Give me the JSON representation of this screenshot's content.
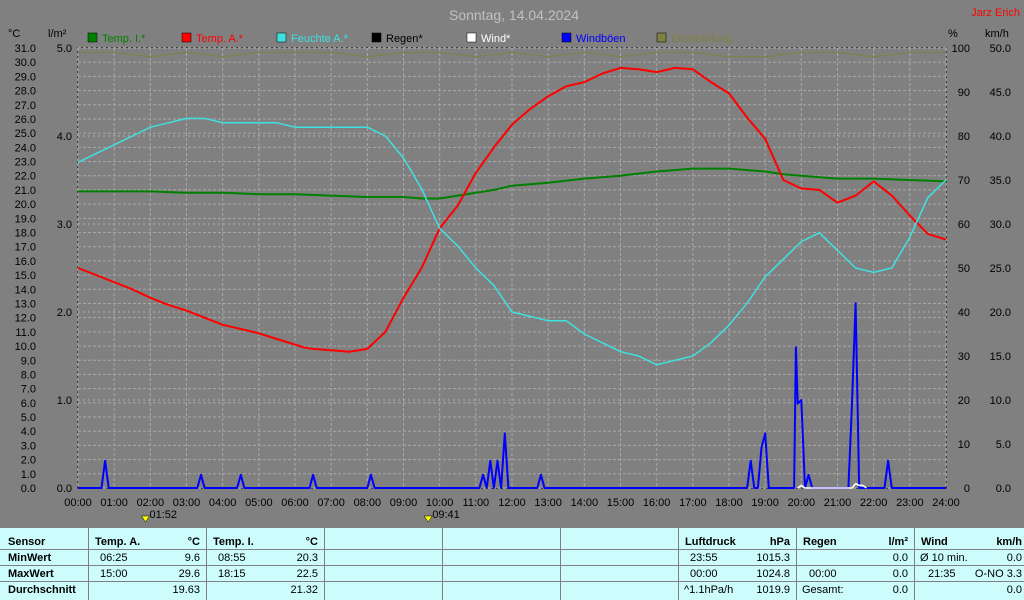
{
  "title": "Sonntag, 14.04.2024",
  "station": "Jarz Erich",
  "units": {
    "left_outer": "°C",
    "left_inner": "l/m²",
    "right_inner": "%",
    "right_outer": "km/h"
  },
  "colors": {
    "bg": "#808080",
    "plot_bg": "#808080",
    "grid": "#a8a8a8",
    "temp_in": "#008000",
    "temp_out": "#ff0000",
    "humidity": "#40e0e0",
    "rain": "#000000",
    "wind": "#ffffff",
    "gust": "#0000ff",
    "solar": "#808040"
  },
  "chart_data": {
    "type": "line",
    "title": "Sonntag, 14.04.2024",
    "x_unit": "hours",
    "xlim": [
      0,
      24
    ],
    "x_ticks": [
      "00:00",
      "01:00",
      "02:00",
      "03:00",
      "04:00",
      "05:00",
      "06:00",
      "07:00",
      "08:00",
      "09:00",
      "10:00",
      "11:00",
      "12:00",
      "13:00",
      "14:00",
      "15:00",
      "16:00",
      "17:00",
      "18:00",
      "19:00",
      "20:00",
      "21:00",
      "22:00",
      "23:00",
      "24:00"
    ],
    "axes": {
      "temp_c": {
        "ylim": [
          0,
          31
        ],
        "ticks": [
          "0.0",
          "1.0",
          "2.0",
          "3.0",
          "4.0",
          "5.0",
          "6.0",
          "7.0",
          "8.0",
          "9.0",
          "10.0",
          "11.0",
          "12.0",
          "13.0",
          "14.0",
          "15.0",
          "16.0",
          "17.0",
          "18.0",
          "19.0",
          "20.0",
          "21.0",
          "22.0",
          "23.0",
          "24.0",
          "25.0",
          "26.0",
          "27.0",
          "28.0",
          "29.0",
          "30.0",
          "31.0"
        ]
      },
      "rain_lm2": {
        "ylim": [
          0,
          5
        ],
        "ticks": [
          "0.0",
          "1.0",
          "2.0",
          "3.0",
          "4.0",
          "5.0"
        ]
      },
      "humidity_pct": {
        "ylim": [
          0,
          100
        ],
        "ticks": [
          "0",
          "10",
          "20",
          "30",
          "40",
          "50",
          "60",
          "70",
          "80",
          "90",
          "100"
        ]
      },
      "wind_kmh": {
        "ylim": [
          0,
          50
        ],
        "ticks": [
          "0.0",
          "5.0",
          "10.0",
          "15.0",
          "20.0",
          "25.0",
          "30.0",
          "35.0",
          "40.0",
          "45.0",
          "50.0"
        ]
      }
    },
    "legend": [
      "Temp. I.*",
      "Temp. A.*",
      "Feuchte A.*",
      "Regen*",
      "Wind*",
      "Windböen",
      "Einstrahlung"
    ],
    "series": [
      {
        "name": "Temp. I.*",
        "axis": "temp_c",
        "color": "#008000",
        "x": [
          0,
          1,
          2,
          3,
          4,
          5,
          6,
          7,
          8,
          9,
          9.5,
          10,
          10.5,
          11,
          11.5,
          12,
          13,
          14,
          15,
          16,
          17,
          18,
          19,
          19.5,
          20,
          21,
          22,
          23,
          24
        ],
        "y": [
          20.9,
          20.9,
          20.9,
          20.8,
          20.8,
          20.7,
          20.7,
          20.6,
          20.5,
          20.5,
          20.4,
          20.4,
          20.6,
          20.8,
          21.0,
          21.3,
          21.5,
          21.8,
          22.0,
          22.3,
          22.5,
          22.5,
          22.3,
          22.1,
          22.0,
          21.8,
          21.8,
          21.7,
          21.6
        ]
      },
      {
        "name": "Temp. A.*",
        "axis": "temp_c",
        "color": "#ff0000",
        "x": [
          0,
          0.5,
          1,
          1.5,
          2,
          2.5,
          3,
          3.5,
          4,
          4.5,
          5,
          5.5,
          6,
          6.25,
          6.5,
          7,
          7.5,
          8,
          8.5,
          9,
          9.5,
          10,
          10.5,
          11,
          11.5,
          12,
          12.5,
          13,
          13.5,
          14,
          14.5,
          15,
          15.5,
          16,
          16.5,
          17,
          17.5,
          18,
          18.5,
          19,
          19.5,
          20,
          20.5,
          21,
          21.5,
          22,
          22.5,
          23,
          23.5,
          24
        ],
        "y": [
          15.5,
          15.0,
          14.5,
          14.0,
          13.4,
          12.9,
          12.5,
          12.0,
          11.5,
          11.2,
          10.9,
          10.5,
          10.1,
          9.9,
          9.8,
          9.7,
          9.6,
          9.8,
          11.0,
          13.4,
          15.5,
          18.3,
          19.9,
          22.2,
          24.0,
          25.6,
          26.7,
          27.6,
          28.3,
          28.6,
          29.2,
          29.6,
          29.5,
          29.3,
          29.6,
          29.5,
          28.6,
          27.8,
          26.1,
          24.6,
          21.7,
          21.1,
          21.0,
          20.1,
          20.6,
          21.6,
          20.6,
          19.2,
          17.9,
          17.5
        ]
      },
      {
        "name": "Feuchte A.*",
        "axis": "humidity_pct",
        "color": "#40e0e0",
        "x": [
          0,
          0.5,
          1,
          1.5,
          2,
          2.5,
          3,
          3.5,
          4,
          4.5,
          5,
          5.5,
          6,
          6.5,
          7,
          7.5,
          8,
          8.5,
          9,
          9.5,
          10,
          10.5,
          11,
          11.5,
          12,
          12.5,
          13,
          13.5,
          14,
          14.5,
          15,
          15.5,
          16,
          16.5,
          17,
          17.5,
          18,
          18.5,
          19,
          19.5,
          20,
          20.5,
          21,
          21.5,
          22,
          22.5,
          23,
          23.5,
          24
        ],
        "y": [
          74,
          76,
          78,
          80,
          82,
          83,
          84,
          84,
          83,
          83,
          83,
          83,
          82,
          82,
          82,
          82,
          82,
          80,
          75,
          68,
          59,
          55,
          50,
          46,
          40,
          39,
          38,
          38,
          35,
          33,
          31,
          30,
          28,
          29,
          30,
          33,
          37,
          42,
          48,
          52,
          56,
          58,
          54,
          50,
          49,
          50,
          57,
          66,
          70
        ]
      },
      {
        "name": "Windböen",
        "axis": "wind_kmh",
        "color": "#0000ff",
        "x": [
          0,
          0.65,
          0.75,
          0.85,
          1,
          3.3,
          3.4,
          3.5,
          4.4,
          4.5,
          4.6,
          6.4,
          6.5,
          6.6,
          8.0,
          8.1,
          8.2,
          11.1,
          11.2,
          11.3,
          11.4,
          11.5,
          11.6,
          11.7,
          11.8,
          11.9,
          12.1,
          12.7,
          12.8,
          12.9,
          13.0,
          18.5,
          18.6,
          18.7,
          18.8,
          18.9,
          19.0,
          19.1,
          19.2,
          19.8,
          19.85,
          19.9,
          20.0,
          20.1,
          20.2,
          20.3,
          21.3,
          21.4,
          21.5,
          21.6,
          22.3,
          22.4,
          22.5,
          24
        ],
        "y": [
          0,
          0,
          3.1,
          0,
          0,
          0,
          1.5,
          0,
          0,
          1.5,
          0,
          0,
          1.5,
          0,
          0,
          1.5,
          0,
          0,
          1.5,
          0,
          3.1,
          0,
          3.1,
          0,
          6.2,
          0,
          0,
          0,
          1.5,
          0,
          0,
          0,
          3.1,
          0,
          0,
          4.6,
          6.2,
          0,
          0,
          0,
          16.0,
          9.6,
          10.0,
          0,
          1.5,
          0,
          0,
          9.6,
          21.0,
          0,
          0,
          3.1,
          0,
          0
        ]
      },
      {
        "name": "Wind*",
        "axis": "wind_kmh",
        "color": "#ffffff",
        "x": [
          19.9,
          20.0,
          20.1,
          21.4,
          21.5,
          21.6,
          21.7,
          21.8
        ],
        "y": [
          0,
          0.3,
          0,
          0,
          0.5,
          0.3,
          0.3,
          0
        ]
      },
      {
        "name": "Einstrahlung",
        "axis": "humidity_pct",
        "color": "#808040",
        "x": [
          0,
          1,
          2,
          3,
          4,
          5,
          6,
          7,
          8,
          9,
          10,
          11,
          12,
          13,
          14,
          15,
          16,
          17,
          18,
          19,
          20,
          21,
          22,
          23,
          24
        ],
        "y": [
          99,
          99,
          98,
          99,
          98,
          99,
          99,
          99,
          98,
          99,
          99,
          98,
          99,
          98,
          99,
          98,
          99,
          99,
          98,
          98,
          99,
          99,
          98,
          99,
          99
        ]
      }
    ],
    "markers": [
      "01:52",
      "09:41"
    ]
  },
  "stats": {
    "header": {
      "sensor": "Sensor",
      "temp_a": "Temp. A.",
      "temp_a_unit": "°C",
      "temp_i": "Temp. I.",
      "temp_i_unit": "°C",
      "pressure": "Luftdruck",
      "pressure_unit": "hPa",
      "rain": "Regen",
      "rain_unit": "l/m²",
      "wind": "Wind",
      "wind_unit": "km/h"
    },
    "rows": [
      {
        "label": "MinWert",
        "ta_time": "06:25",
        "ta_val": "9.6",
        "ti_time": "08:55",
        "ti_val": "20.3",
        "p_time": "23:55",
        "p_val": "1015.3",
        "r_time": "",
        "r_val": "0.0",
        "w_time": "Ø 10 min.",
        "w_val": "0.0"
      },
      {
        "label": "MaxWert",
        "ta_time": "15:00",
        "ta_val": "29.6",
        "ti_time": "18:15",
        "ti_val": "22.5",
        "p_time": "00:00",
        "p_val": "1024.8",
        "r_time": "00:00",
        "r_val": "0.0",
        "w_time": "21:35",
        "w_val": "O-NO 3.3"
      },
      {
        "label": "Durchschnitt",
        "ta_time": "",
        "ta_val": "19.63",
        "ti_time": "",
        "ti_val": "21.32",
        "p_time": "^1.1hPa/h",
        "p_val": "1019.9",
        "r_time": "Gesamt:",
        "r_val": "0.0",
        "w_time": "",
        "w_val": "0.0"
      }
    ]
  }
}
